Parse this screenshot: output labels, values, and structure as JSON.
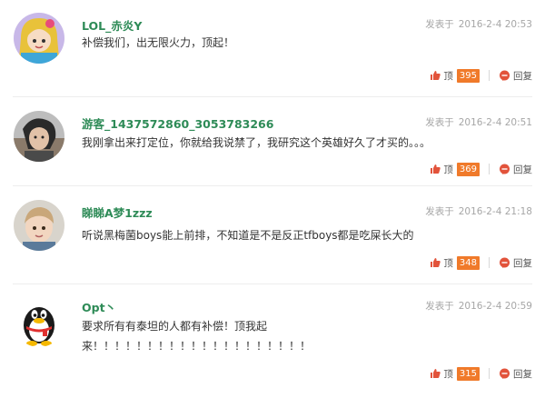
{
  "comments": [
    {
      "username": "LOL_赤炎Y",
      "prefix": "发表于",
      "date": "2016-2-4 20:53",
      "lines": [
        "补偿我们，出无限火力，顶起！"
      ],
      "like_label": "顶",
      "likes": "395",
      "reply_label": "回复"
    },
    {
      "username": "游客_1437572860_3053783266",
      "prefix": "发表于",
      "date": "2016-2-4 20:51",
      "lines": [
        "我刚拿出来打定位，你就给我说禁了，我研究这个英雄好久了才买的。。。"
      ],
      "like_label": "顶",
      "likes": "369",
      "reply_label": "回复"
    },
    {
      "username": "睇睇A梦1zzz",
      "prefix": "发表于",
      "date": "2016-2-4 21:18",
      "lines": [
        "听说黑梅菌boys能上前排，不知道是不是反正tfboys都是吃屎长大的"
      ],
      "like_label": "顶",
      "likes": "348",
      "reply_label": "回复"
    },
    {
      "username": "Opt丶",
      "prefix": "发表于",
      "date": "2016-2-4 20:59",
      "lines": [
        "要求所有有泰坦的人都有补偿！顶我起",
        "来！！！！！！！！！！！！！！！！！！！！"
      ],
      "like_label": "顶",
      "likes": "315",
      "reply_label": "回复"
    }
  ],
  "colors": {
    "username": "#2e8b57",
    "count_badge": "#f07a2a",
    "icon": "#e2533b"
  }
}
